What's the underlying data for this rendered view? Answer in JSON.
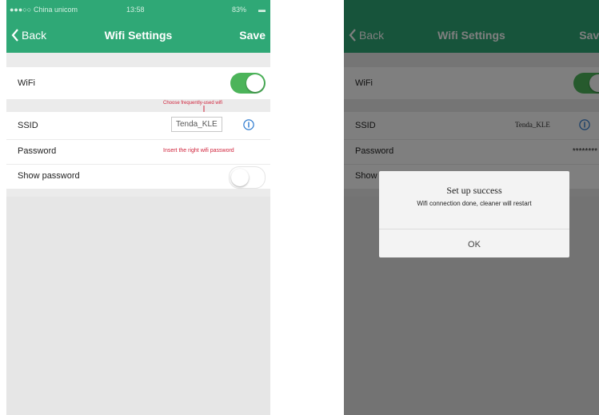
{
  "left": {
    "status": {
      "carrier": "China unicom",
      "time": "13:58",
      "battery": "83%"
    },
    "nav": {
      "back_label": "Back",
      "title": "Wifi Settings",
      "save_label": "Save"
    },
    "rows": {
      "wifi_label": "WiFi",
      "ssid_label": "SSID",
      "ssid_value": "Tenda_KLE",
      "password_label": "Password",
      "show_password_label": "Show password"
    },
    "annotations": {
      "choose_wifi": "Choose frequently-used wifi",
      "insert_password": "Insert the right wifi password"
    },
    "toggles": {
      "wifi_on": true,
      "show_password_on": false
    }
  },
  "right": {
    "nav": {
      "back_label": "Back",
      "title": "Wifi Settings",
      "save_label": "Save"
    },
    "rows": {
      "wifi_label": "WiFi",
      "ssid_label": "SSID",
      "ssid_value": "Tenda_KLE",
      "password_label": "Password",
      "password_value": "********",
      "show_password_label": "Show"
    },
    "dialog": {
      "title": "Set up success",
      "message": "Wifi connection done, cleaner will restart",
      "ok_label": "OK"
    }
  },
  "colors": {
    "brand_green": "#2fa876",
    "toggle_green": "#4cb45a",
    "annotation_red": "#d0243c"
  }
}
